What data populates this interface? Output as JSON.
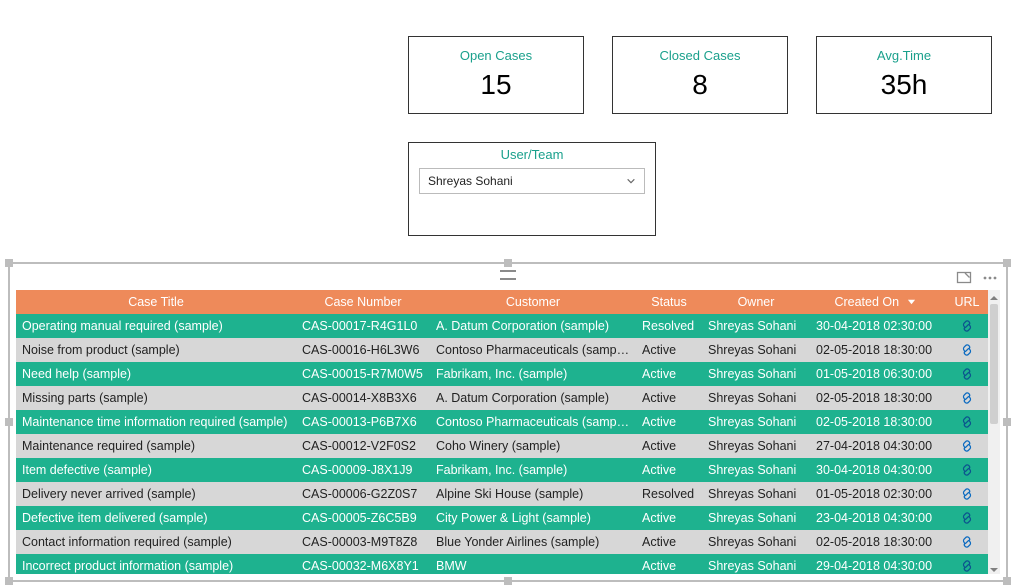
{
  "kpis": [
    {
      "label": "Open Cases",
      "value": "15"
    },
    {
      "label": "Closed Cases",
      "value": "8"
    },
    {
      "label": "Avg.Time",
      "value": "35h"
    }
  ],
  "filter": {
    "label": "User/Team",
    "selected": "Shreyas Sohani"
  },
  "table": {
    "columns": [
      "Case Title",
      "Case Number",
      "Customer",
      "Status",
      "Owner",
      "Created On",
      "URL"
    ],
    "sort_column_index": 5,
    "sort_dir": "desc",
    "rows": [
      {
        "title": "Operating manual required (sample)",
        "number": "CAS-00017-R4G1L0",
        "customer": "A. Datum Corporation (sample)",
        "status": "Resolved",
        "owner": "Shreyas Sohani",
        "created": "30-04-2018 02:30:00",
        "url": true
      },
      {
        "title": "Noise from product (sample)",
        "number": "CAS-00016-H6L3W6",
        "customer": "Contoso Pharmaceuticals (sample)",
        "status": "Active",
        "owner": "Shreyas Sohani",
        "created": "02-05-2018 18:30:00",
        "url": true
      },
      {
        "title": "Need help (sample)",
        "number": "CAS-00015-R7M0W5",
        "customer": "Fabrikam, Inc. (sample)",
        "status": "Active",
        "owner": "Shreyas Sohani",
        "created": "01-05-2018 06:30:00",
        "url": true
      },
      {
        "title": "Missing parts (sample)",
        "number": "CAS-00014-X8B3X6",
        "customer": "A. Datum Corporation (sample)",
        "status": "Active",
        "owner": "Shreyas Sohani",
        "created": "02-05-2018 18:30:00",
        "url": true
      },
      {
        "title": "Maintenance time information required (sample)",
        "number": "CAS-00013-P6B7X6",
        "customer": "Contoso Pharmaceuticals (sample)",
        "status": "Active",
        "owner": "Shreyas Sohani",
        "created": "02-05-2018 18:30:00",
        "url": true
      },
      {
        "title": "Maintenance required (sample)",
        "number": "CAS-00012-V2F0S2",
        "customer": "Coho Winery (sample)",
        "status": "Active",
        "owner": "Shreyas Sohani",
        "created": "27-04-2018 04:30:00",
        "url": true
      },
      {
        "title": "Item defective (sample)",
        "number": "CAS-00009-J8X1J9",
        "customer": "Fabrikam, Inc. (sample)",
        "status": "Active",
        "owner": "Shreyas Sohani",
        "created": "30-04-2018 04:30:00",
        "url": true
      },
      {
        "title": "Delivery never arrived (sample)",
        "number": "CAS-00006-G2Z0S7",
        "customer": "Alpine Ski House (sample)",
        "status": "Resolved",
        "owner": "Shreyas Sohani",
        "created": "01-05-2018 02:30:00",
        "url": true
      },
      {
        "title": "Defective item delivered (sample)",
        "number": "CAS-00005-Z6C5B9",
        "customer": "City Power & Light (sample)",
        "status": "Active",
        "owner": "Shreyas Sohani",
        "created": "23-04-2018 04:30:00",
        "url": true
      },
      {
        "title": "Contact information required (sample)",
        "number": "CAS-00003-M9T8Z8",
        "customer": "Blue Yonder Airlines (sample)",
        "status": "Active",
        "owner": "Shreyas Sohani",
        "created": "02-05-2018 18:30:00",
        "url": true
      },
      {
        "title": "Incorrect product information (sample)",
        "number": "CAS-00032-M6X8Y1",
        "customer": "BMW",
        "status": "Active",
        "owner": "Shreyas Sohani",
        "created": "29-04-2018 04:30:00",
        "url": true
      }
    ]
  }
}
